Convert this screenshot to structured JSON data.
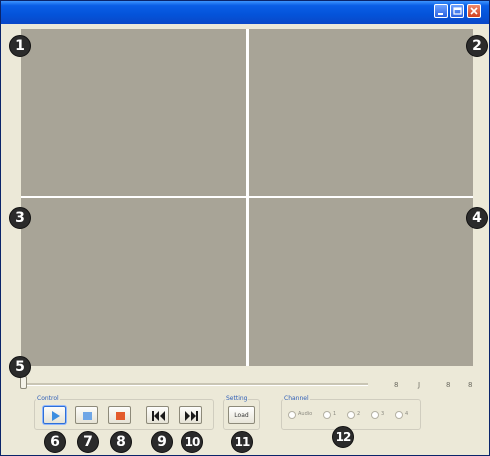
{
  "window": {
    "title": "",
    "controls": {
      "minimize": "minimize-icon",
      "maximize": "maximize-icon",
      "close": "close-icon"
    }
  },
  "callouts": [
    "1",
    "2",
    "3",
    "4",
    "5",
    "6",
    "7",
    "8",
    "9",
    "10",
    "11",
    "12"
  ],
  "timeline": {
    "marks": [
      "8",
      "J",
      "8",
      "8"
    ]
  },
  "control": {
    "group_label": "Control",
    "buttons": [
      {
        "name": "play",
        "icon": "play-icon"
      },
      {
        "name": "pause",
        "icon": "pause-icon"
      },
      {
        "name": "stop",
        "icon": "stop-icon"
      },
      {
        "name": "previous",
        "icon": "skip-back-icon"
      },
      {
        "name": "next",
        "icon": "skip-forward-icon"
      }
    ]
  },
  "setting": {
    "group_label": "Setting",
    "load_label": "Load"
  },
  "channel": {
    "group_label": "Channel",
    "options": [
      "Audio",
      "1",
      "2",
      "3",
      "4"
    ]
  },
  "colors": {
    "video_pane": "#a8a497",
    "title_bar": "#0453d9",
    "window_bg": "#ece9d8",
    "play_accent": "#3b8de0",
    "stop_accent": "#e35a2c"
  }
}
